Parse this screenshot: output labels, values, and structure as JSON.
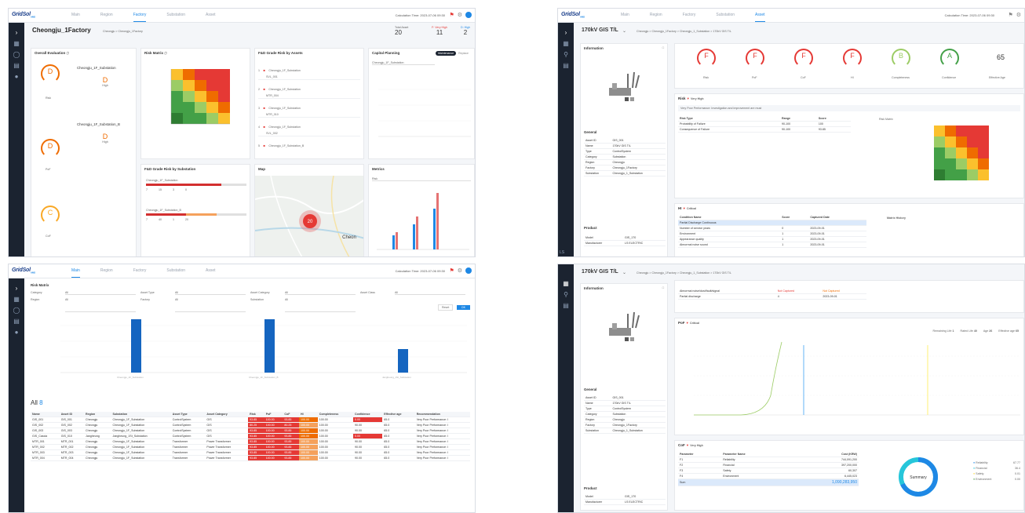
{
  "app": {
    "logo_main": "GridSol",
    "logo_sub": "AMS",
    "calc_time": "Calculation Time: 2023-07-06 09:30"
  },
  "nav": {
    "tabs": [
      "Main",
      "Region",
      "Factory",
      "Substation",
      "Asset"
    ]
  },
  "panel1": {
    "title": "Cheongju_1Factory",
    "breadcrumb": "Cheongju > Cheongju_1Factory",
    "totals": [
      {
        "label": "Total Asset",
        "value": "20"
      },
      {
        "label": "F: Very High",
        "value": "11"
      },
      {
        "label": "D: High",
        "value": "2"
      }
    ],
    "overall_title": "Overall Evaluation",
    "gauges": [
      {
        "grade": "D",
        "label": "Risk",
        "color": "#ef6c00"
      },
      {
        "grade": "D",
        "label": "PoF",
        "color": "#ef6c00"
      },
      {
        "grade": "C",
        "label": "CoF",
        "color": "#f9a825"
      }
    ],
    "substations": [
      {
        "name": "Cheongju_1F_Substation",
        "grade": "D",
        "level": "High"
      },
      {
        "name": "Cheongju_1F_Substation_B",
        "grade": "D",
        "level": "High"
      }
    ],
    "risk_matrix_title": "Risk Matrix",
    "fd_grade_title": "F&D Grade Risk by Assets",
    "fd_items": [
      {
        "rank": "1",
        "name": "Cheongju_1F_Substation",
        "sub": "SVL_001"
      },
      {
        "rank": "2",
        "name": "Cheongju_1F_Substation",
        "sub": "MTR_004"
      },
      {
        "rank": "3",
        "name": "Cheongju_1F_Substation",
        "sub": "MTR_010"
      },
      {
        "rank": "4",
        "name": "Cheongju_1F_Substation",
        "sub": "SVL_002"
      },
      {
        "rank": "5",
        "name": "Cheongju_1F_Substation_B",
        "sub": ""
      }
    ],
    "capital_title": "Capital Planning",
    "capital_select": "Cheongju_1F_Substation",
    "capital_toggle": [
      "Maintenance",
      "Replace"
    ],
    "fd_sub_title": "F&D Grade Risk by Substation",
    "fd_sub_items": [
      {
        "name": "Cheongju_1F_Substation",
        "counts": [
          "7",
          "15",
          "3",
          "0"
        ]
      },
      {
        "name": "Cheongju_1F_Substation_B",
        "counts": [
          "7",
          "40",
          "1",
          "20"
        ]
      }
    ],
    "map_title": "Map",
    "map_cluster": "20",
    "map_city": "Cheon",
    "metrics_title": "Metrics",
    "metrics_select": "Risk"
  },
  "panel2": {
    "title": "170kV GIS T/L",
    "breadcrumb": "Cheongju > Cheongju_1Factory > Cheongju_1_Substation > 170kV GIS T/L",
    "info_title": "Information",
    "general_title": "General",
    "general_rows": [
      {
        "k": "Asset ID",
        "v": "GIS_001"
      },
      {
        "k": "Name",
        "v": "170kV GIS T/L"
      },
      {
        "k": "Type",
        "v": "ControlSystem"
      },
      {
        "k": "Category",
        "v": "Substation"
      },
      {
        "k": "Region",
        "v": "Cheongju"
      },
      {
        "k": "Factory",
        "v": "Cheongju_1Factory"
      },
      {
        "k": "Substation",
        "v": "Cheongju_1_Substation"
      }
    ],
    "product_title": "Product",
    "product_rows": [
      {
        "k": "Model",
        "v": "GIS_170"
      },
      {
        "k": "Manufacturer",
        "v": "LS ELECTRIC"
      }
    ],
    "gauges": [
      {
        "grade": "F",
        "label": "Risk",
        "color": "#e53935"
      },
      {
        "grade": "F",
        "label": "PoF",
        "color": "#e53935"
      },
      {
        "grade": "F",
        "label": "CoF",
        "color": "#e53935"
      },
      {
        "grade": "F",
        "label": "HI",
        "color": "#e53935"
      },
      {
        "grade": "B",
        "label": "Completeness",
        "color": "#9ccc65"
      },
      {
        "grade": "A",
        "label": "Confidence",
        "color": "#43a047"
      }
    ],
    "effective_age": "65",
    "effective_age_label": "Effective Age",
    "risk_title": "Risk",
    "risk_badge": "Very High",
    "recommendation": "Very Poor Performance: Investigation and improvement are must",
    "risk_table_head": [
      "Risk Type",
      "Range",
      "Score"
    ],
    "risk_table_rows": [
      [
        "Probability of Failure",
        "90-100",
        "100"
      ],
      [
        "Consequence of Failure",
        "90-100",
        "93.85"
      ]
    ],
    "risk_matrix_label": "Risk Matrix",
    "hi_title": "HI",
    "hi_badge": "Critical",
    "cond_head": [
      "Condition Name",
      "Score",
      "Captured Date",
      "Matrix History"
    ],
    "cond_rows": [
      [
        "Partial Discharge Continuous",
        "",
        ""
      ],
      [
        "Number of service years",
        "0",
        "2023-09-01"
      ],
      [
        "Environment",
        "1",
        "2023-09-01"
      ],
      [
        "Appearance quality",
        "1",
        "2023-09-01"
      ],
      [
        "Abnormal noise sound",
        "1",
        "2023-09-01"
      ]
    ]
  },
  "panel3": {
    "section_title": "Risk Matrix",
    "filters": [
      {
        "label": "Category",
        "value": "All"
      },
      {
        "label": "Asset Type",
        "value": "All"
      },
      {
        "label": "Asset Category",
        "value": "All"
      },
      {
        "label": "Asset Class",
        "value": "All"
      },
      {
        "label": "Region",
        "value": "All"
      },
      {
        "label": "Factory",
        "value": "All"
      },
      {
        "label": "Substation",
        "value": "All"
      }
    ],
    "reset_label": "Reset",
    "search_label": "OK",
    "bar_labels": [
      "Cheongju_1F_Substation",
      "Cheongju_1F_Substation_B",
      "Jangheung_1St_Substation"
    ],
    "all_label": "All",
    "all_count": "8",
    "table_head": [
      "Name",
      "Asset ID",
      "Region",
      "Substation",
      "Asset Type",
      "Asset Category",
      "Risk",
      "PoF",
      "CoF",
      "HI",
      "Completeness",
      "Confidence",
      "Effective age",
      "Recommendation"
    ],
    "table_rows": [
      [
        "GIS_001",
        "GIS_001",
        "Cheongju",
        "Cheongju_1F_Substation",
        "ControlSystem",
        "GIS",
        "93.85",
        "100.00",
        "93.85",
        "100.00",
        "100.00",
        "0.00",
        "65.0",
        "Very Poor Performance: I"
      ],
      [
        "GIS_002",
        "GIS_002",
        "Cheongju",
        "Cheongju_1F_Substation",
        "ControlSystem",
        "GIS",
        "80.25",
        "100.00",
        "80.25",
        "100.00",
        "100.00",
        "90.00",
        "65.0",
        "Very Poor Performance: I"
      ],
      [
        "GIS_003",
        "GIS_003",
        "Cheongju",
        "Cheongju_1F_Substation",
        "ControlSystem",
        "GIS",
        "93.85",
        "100.00",
        "93.85",
        "100.00",
        "100.00",
        "90.00",
        "65.0",
        "Very Poor Performance: I"
      ],
      [
        "GIS_Cascia",
        "GIS_010",
        "Jangheung",
        "Jangheung_1St_Substation",
        "ControlSystem",
        "GIS",
        "93.85",
        "100.00",
        "93.85",
        "100.00",
        "100.00",
        "0.00",
        "65.0",
        "Very Poor Performance: I"
      ],
      [
        "MTR_001",
        "MTR_001",
        "Cheongju",
        "Cheongju_1F_Substation",
        "Transformer",
        "Power Transformer",
        "93.85",
        "100.00",
        "93.85",
        "100.00",
        "100.00",
        "90.00",
        "65.0",
        "Very Poor Performance: I"
      ],
      [
        "MTR_002",
        "MTR_002",
        "Cheongju",
        "Cheongju_1F_Substation",
        "Transformer",
        "Power Transformer",
        "93.85",
        "100.00",
        "93.85",
        "100.00",
        "100.00",
        "90.00",
        "65.0",
        "Very Poor Performance: I"
      ],
      [
        "MTR_003",
        "MTR_003",
        "Cheongju",
        "Cheongju_1F_Substation",
        "Transformer",
        "Power Transformer",
        "93.85",
        "100.00",
        "93.85",
        "100.00",
        "100.00",
        "90.00",
        "65.0",
        "Very Poor Performance: I"
      ],
      [
        "MTR_004",
        "MTR_004",
        "Cheongju",
        "Cheongju_1F_Substation",
        "Transformer",
        "Power Transformer",
        "93.85",
        "100.00",
        "93.85",
        "100.00",
        "100.00",
        "90.00",
        "65.0",
        "Very Poor Performance: I"
      ]
    ]
  },
  "panel4": {
    "title": "170kV GIS T/L",
    "breadcrumb": "Cheongju > Cheongju_1Factory > Cheongju_1_Substation > 170kV GIS T/L",
    "info_title": "Information",
    "top_rows": [
      [
        "Abnormal noise/dust/fault/signal",
        "Not Captured",
        "Not Captured"
      ],
      [
        "Partial discharge",
        "4",
        "2023-09-01"
      ]
    ],
    "pof_title": "PoF",
    "pof_badge": "Critical",
    "pof_stats": [
      {
        "label": "Remaining Life",
        "value": "1"
      },
      {
        "label": "Rated Life",
        "value": "40"
      },
      {
        "label": "Age",
        "value": "26"
      },
      {
        "label": "Effective age",
        "value": "65"
      }
    ],
    "general_title": "General",
    "general_rows": [
      {
        "k": "Asset ID",
        "v": "GIS_001"
      },
      {
        "k": "Name",
        "v": "170kV GIS T/L"
      },
      {
        "k": "Type",
        "v": "ControlSystem"
      },
      {
        "k": "Category",
        "v": "Substation"
      },
      {
        "k": "Region",
        "v": "Cheongju"
      },
      {
        "k": "Factory",
        "v": "Cheongju_1Factory"
      },
      {
        "k": "Substation",
        "v": "Cheongju_1_Substation"
      }
    ],
    "product_title": "Product",
    "product_rows": [
      {
        "k": "Model",
        "v": "GIS_170"
      },
      {
        "k": "Manufacturer",
        "v": "LS ELECTRIC"
      }
    ],
    "cof_title": "CoF",
    "cof_badge": "Very High",
    "cof_head": [
      "Parameter",
      "Parameter Name",
      "Cost (KRW)"
    ],
    "cof_rows": [
      [
        "F1",
        "Reliability",
        "744,091,200"
      ],
      [
        "F2",
        "Financial",
        "397,200,000"
      ],
      [
        "F3",
        "Safety",
        "60,307"
      ],
      [
        "F4",
        "Environment",
        "6,445,023"
      ],
      [
        "Sum",
        "",
        "1,090,283,950"
      ]
    ],
    "summary_label": "Summary",
    "legend": [
      {
        "name": "Reliability",
        "value": "67.77",
        "color": "#1e88e5"
      },
      {
        "name": "Financial",
        "value": "36.4",
        "color": "#26c6da"
      },
      {
        "name": "Safety",
        "value": "0.01",
        "color": "#fdd835"
      },
      {
        "name": "Environment",
        "value": "0.00",
        "color": "#43a047"
      }
    ]
  }
}
